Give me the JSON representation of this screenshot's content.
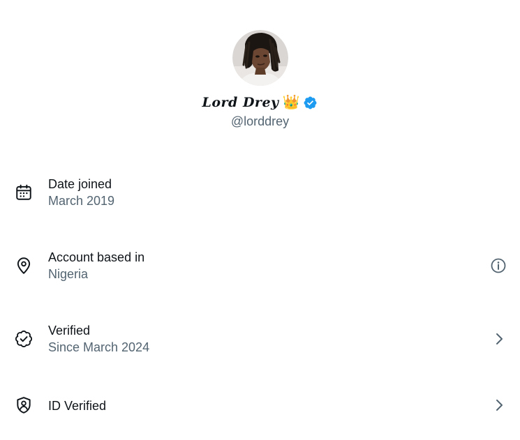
{
  "profile": {
    "display_name": "𝑳𝒐𝒓𝒅 𝑫𝒓𝒆𝒚",
    "crown_emoji": "👑",
    "handle": "@lorddrey",
    "verified_badge_color": "#1d9bf0"
  },
  "rows": [
    {
      "icon": "calendar-icon",
      "title": "Date joined",
      "subtitle": "March 2019",
      "action": "none"
    },
    {
      "icon": "location-pin-icon",
      "title": "Account based in",
      "subtitle": "Nigeria",
      "action": "info-icon"
    },
    {
      "icon": "verified-check-icon",
      "title": "Verified",
      "subtitle": "Since March 2024",
      "action": "chevron-right-icon"
    },
    {
      "icon": "shield-person-icon",
      "title": "ID Verified",
      "subtitle": "",
      "action": "chevron-right-icon"
    }
  ],
  "colors": {
    "primary_text": "#0f1419",
    "secondary_text": "#536471",
    "accent": "#1d9bf0"
  }
}
